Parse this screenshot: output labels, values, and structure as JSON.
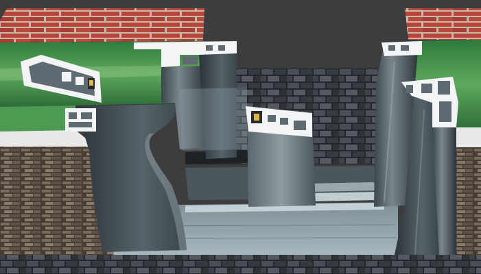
{
  "scene": {
    "description_visible_text": [],
    "colors": {
      "sky": "#3d3d3d",
      "brick": "#b5443a",
      "mortar": "#c9b7a8",
      "glass_green": "#3f8f4e",
      "glass_green_light": "#7fb76f",
      "wall_cap": "#e6e6e6",
      "stone": "#6e6255",
      "stone_dark": "#463d34",
      "floor_tile": "#2f3337",
      "back_tile": "#3b3f44",
      "profile_metal": "#5f6b72",
      "profile_dark": "#2f3a40",
      "profile_light": "#b9c4c9",
      "section_white": "#f2f4f5",
      "sill": "#8a9aa3"
    }
  }
}
